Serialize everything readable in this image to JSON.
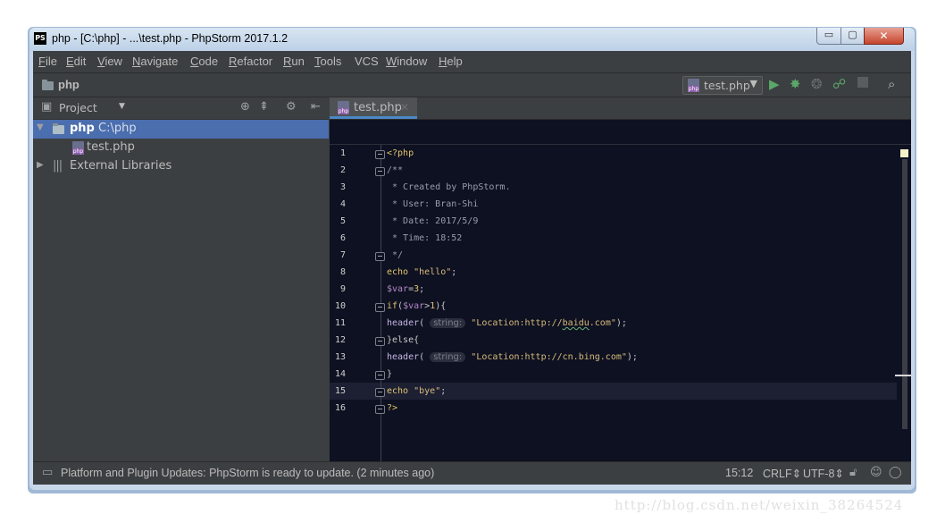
{
  "window": {
    "title": "php - [C:\\php] - ...\\test.php - PhpStorm 2017.1.2",
    "app_icon_text": "PS",
    "controls": {
      "minimize": "▭",
      "maximize": "▢",
      "close": "✕"
    }
  },
  "menu": [
    {
      "label": "File",
      "mnemonic": "F",
      "rest": "ile"
    },
    {
      "label": "Edit",
      "mnemonic": "E",
      "rest": "dit"
    },
    {
      "label": "View",
      "mnemonic": "V",
      "rest": "iew"
    },
    {
      "label": "Navigate",
      "mnemonic": "N",
      "rest": "avigate"
    },
    {
      "label": "Code",
      "mnemonic": "C",
      "rest": "ode"
    },
    {
      "label": "Refactor",
      "mnemonic": "R",
      "rest": "efactor"
    },
    {
      "label": "Run",
      "mnemonic": "R",
      "rest": "un"
    },
    {
      "label": "Tools",
      "mnemonic": "T",
      "rest": "ools"
    },
    {
      "label": "VCS",
      "mnemonic": "",
      "rest": "VCS"
    },
    {
      "label": "Window",
      "mnemonic": "W",
      "rest": "indow"
    },
    {
      "label": "Help",
      "mnemonic": "H",
      "rest": "elp"
    }
  ],
  "navbar": {
    "project": "php",
    "run_config": "test.php",
    "icons": [
      "run-icon",
      "debug-icon",
      "coverage-icon",
      "attach-debugger-icon",
      "stop-icon",
      "search-everywhere-icon"
    ]
  },
  "project_pane": {
    "title": "Project",
    "tree": [
      {
        "label": "php",
        "path": "C:\\php",
        "expanded": true,
        "selected": true
      },
      {
        "label": "test.php"
      },
      {
        "label": "External Libraries",
        "expanded": false
      }
    ]
  },
  "editor": {
    "tab": "test.php",
    "line_numbers": [
      "1",
      "2",
      "3",
      "4",
      "5",
      "6",
      "7",
      "8",
      "9",
      "10",
      "11",
      "12",
      "13",
      "14",
      "15",
      "16"
    ],
    "lines": {
      "l1": "<?php",
      "l2": "/**",
      "l3": " * Created by PhpStorm.",
      "l4": " * User: Bran-Shi",
      "l5": " * Date: 2017/5/9",
      "l6": " * Time: 18:52",
      "l7": " */",
      "l8_kw": "echo",
      "l8_str": "\"hello\"",
      "l8_end": ";",
      "l9_var": "$var",
      "l9_op": "=",
      "l9_num": "3",
      "l9_end": ";",
      "l10_kw": "if",
      "l10_open": "(",
      "l10_var": "$var",
      "l10_op": ">",
      "l10_num": "1",
      "l10_end": "){",
      "l11_fn": "header",
      "l11_open": "(",
      "l11_hint": "string:",
      "l11_str_a": "\"Location:http://",
      "l11_str_b": "baidu",
      "l11_str_c": ".com\"",
      "l11_end": ");",
      "l12": "}else{",
      "l13_fn": "header",
      "l13_open": "(",
      "l13_hint": "string:",
      "l13_str": "\"Location:http://cn.bing.com\"",
      "l13_end": ");",
      "l14": "}",
      "l15_kw": "echo",
      "l15_str": "\"bye\"",
      "l15_end": ";",
      "l16": "?>"
    }
  },
  "status": {
    "message": "Platform and Plugin Updates: PhpStorm is ready to update. (2 minutes ago)",
    "position": "15:12",
    "line_sep": "CRLF",
    "encoding": "UTF-8"
  },
  "watermark": "http://blog.csdn.net/weixin_38264524",
  "colors": {
    "ide_bg": "#3c3f41",
    "editor_bg": "#0e1121",
    "selection": "#4b6eaf",
    "run_green": "#59a869"
  }
}
